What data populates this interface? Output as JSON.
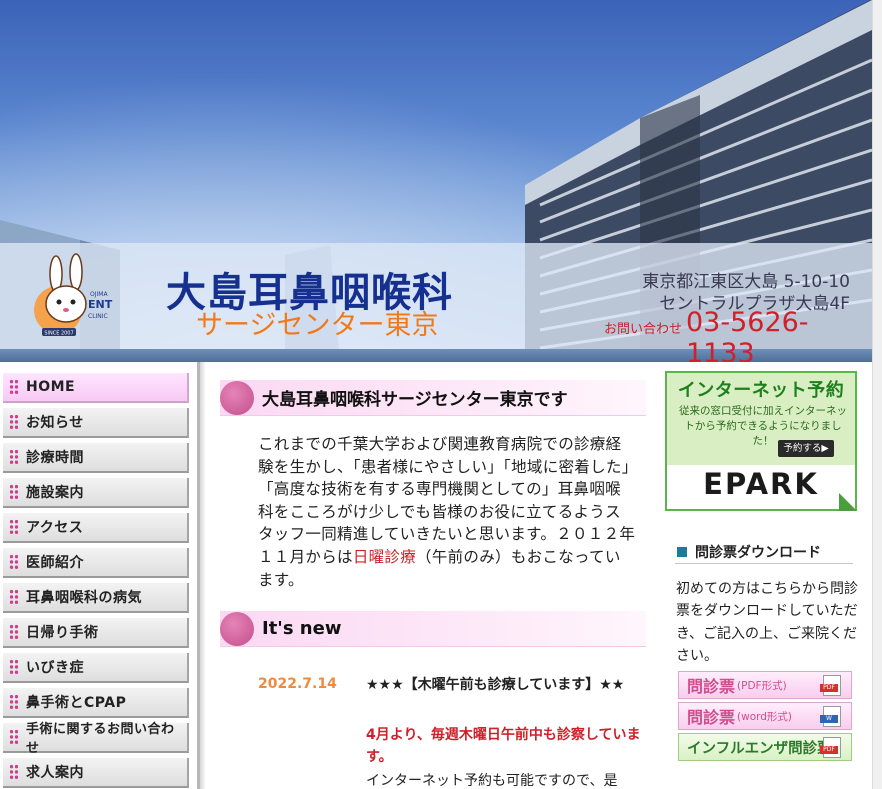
{
  "header": {
    "logo_texts": [
      "OJIMA",
      "ENT",
      "CLINIC",
      "SINCE 2007"
    ],
    "clinic_name": "大島耳鼻咽喉科",
    "clinic_subtitle": "サージセンター東京",
    "address_line1": "東京都江東区大島 5-10-10",
    "address_line2": "セントラルプラザ大島4F",
    "tel_label": "お問い合わせ",
    "tel": "03-5626-1133"
  },
  "nav": {
    "items": [
      {
        "label": "HOME",
        "active": true
      },
      {
        "label": "お知らせ"
      },
      {
        "label": "診療時間"
      },
      {
        "label": "施設案内"
      },
      {
        "label": "アクセス"
      },
      {
        "label": "医師紹介"
      },
      {
        "label": "耳鼻咽喉科の病気"
      },
      {
        "label": "日帰り手術"
      },
      {
        "label": "いびき症"
      },
      {
        "label": "鼻手術とCPAP"
      },
      {
        "label": "手術に関するお問い合わせ"
      },
      {
        "label": "求人案内"
      }
    ]
  },
  "main": {
    "welcome_heading": "大島耳鼻咽喉科サージセンター東京です",
    "intro_text_1": "これまでの千葉大学および関連教育病院での診療経験を生かし、「患者様にやさしい」「地域に密着した」「高度な技術を有する専門機関としての」耳鼻咽喉科をこころがけ少しでも皆様のお役に立てるようスタッフ一同精進していきたいと思います。２０１２年１１月からは",
    "intro_highlight": "日曜診療",
    "intro_text_2": "（午前のみ）もおこなっています。",
    "news_heading": "It's new",
    "news": {
      "date": "2022.7.14",
      "title": "★★★【木曜午前も診療しています】★★",
      "highlight": "4月より、毎週木曜日午前中も診察しています。",
      "body": "インターネット予約も可能ですので、是"
    }
  },
  "sidebar": {
    "epark": {
      "heading": "インターネット予約",
      "description": "従来の窓口受付に加えインターネットから予約できるようになりました！",
      "button": "予約する▶",
      "brand": "EPARK"
    },
    "download": {
      "heading": "問診票ダウンロード",
      "text": "初めての方はこちらから問診票をダウンロードしていただき、ご記入の上、ご来院ください。",
      "buttons": [
        {
          "main": "問診票",
          "sub": "(PDF形式)",
          "icon": "pdf-icon",
          "icon_text": "PDF"
        },
        {
          "main": "問診票",
          "sub": "(word形式)",
          "icon": "word-icon",
          "icon_text": "W"
        },
        {
          "main": "インフルエンザ問診票",
          "sub": "",
          "icon": "pdf-icon",
          "icon_text": "PDF"
        }
      ]
    }
  },
  "colors": {
    "nav_active": "#f7c9f4",
    "nav_dots": "#d23c8c",
    "heading_dot": "#c44e8e",
    "accent_red": "#d0202a",
    "date_orange": "#f08a3c",
    "epark_green": "#5ab54a",
    "clinic_blue": "#15308f",
    "clinic_orange": "#f07a1a"
  }
}
